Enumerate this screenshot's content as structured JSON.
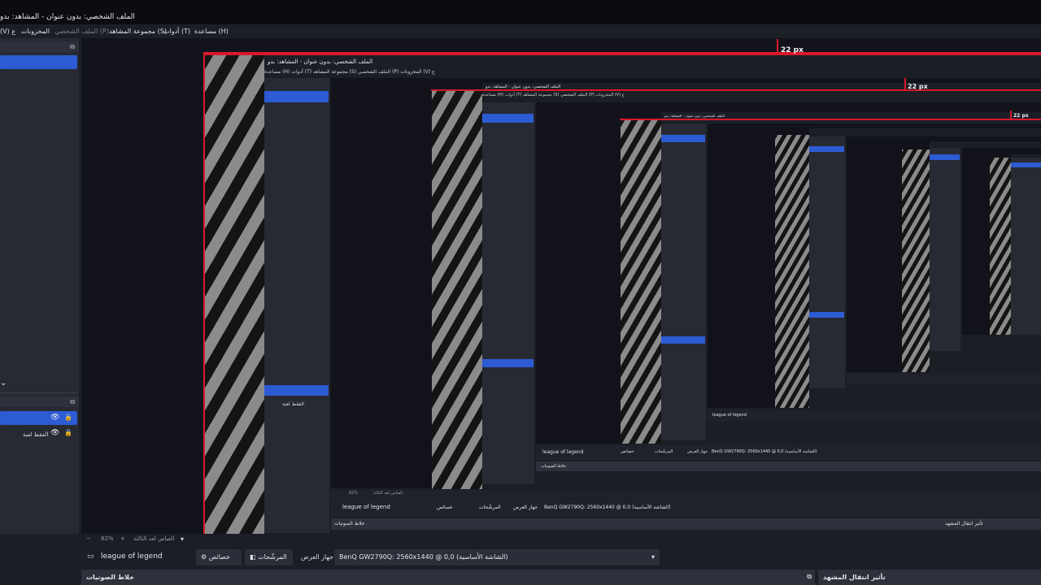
{
  "window": {
    "title": "الملف الشخصي: بدون عنوان - المشاهد: بدو"
  },
  "menu": {
    "items": [
      {
        "label": "مساعدة (H)",
        "disabled": false
      },
      {
        "label": "أدوات (T)",
        "disabled": false
      },
      {
        "label": "مجموعة المشاهد (S)",
        "disabled": false
      },
      {
        "label": "الملف الشخصي (P)",
        "disabled": true
      },
      {
        "label": "المخزونات",
        "disabled": false
      },
      {
        "label": "(V) ع",
        "disabled": false
      }
    ]
  },
  "left_panel": {
    "float_icon": "dock-float-icon",
    "collapse_icon": "chevron-down-icon",
    "sources": [
      {
        "label": "",
        "visible_icon": "eye-icon",
        "lock_icon": "lock-icon",
        "selected": true
      },
      {
        "label": "الفقط لعبة",
        "visible_icon": "eye-icon",
        "lock_icon": "lock-icon",
        "selected": false
      }
    ]
  },
  "preview": {
    "measure_label_1": "22 px",
    "measure_label_2": "22 px",
    "measure_label_3": "22 px",
    "nested_title": "الملف الشخصي: بدون عنوان - المشاهد: بدو",
    "nested_menu": "مساعدة (H)   أدوات (T)   مجموعة المشاهد (S)   الملف الشخصي (P)   المخزونات   (V) ع",
    "nested_source_1": "الفقط لعبة",
    "nested_toolbar_name": "league of legend",
    "nested_props": "خصائص",
    "nested_filters": "المرشّحات",
    "nested_device_label": "جهاز العرض",
    "nested_device_value": "BenQ GW2790Q: 2560x1440 @ 0,0 (الشاشة الأساسية)",
    "nested_audio": "خلاط الصوتيات",
    "nested_transition": "تأثير انتقال المشهد",
    "nested_zoom": "82%",
    "nested_zoom_label": "القياس لعد الثالثة"
  },
  "status": {
    "minus": "−",
    "zoom": "82%",
    "plus": "+",
    "zoom_label": "القياس لعد الثالثة",
    "dropdown_icon": "chevron-down-icon"
  },
  "source_toolbar": {
    "source_name": "league of legend",
    "properties_label": "خصائص",
    "filters_label": "المرشّحات",
    "device_label": "جهاز العرض",
    "device_value": "BenQ GW2790Q: 2560x1440 @ 0,0 (الشاشة الأساسية)"
  },
  "bottom_docks": {
    "audio_mixer": "خلاط الصوتيات",
    "scene_transition": "تأثير انتقال المشهد"
  },
  "colors": {
    "accent": "#2d5bd3",
    "red_guide": "#d8192b",
    "background": "#1c1e26",
    "panel": "#272a33"
  }
}
